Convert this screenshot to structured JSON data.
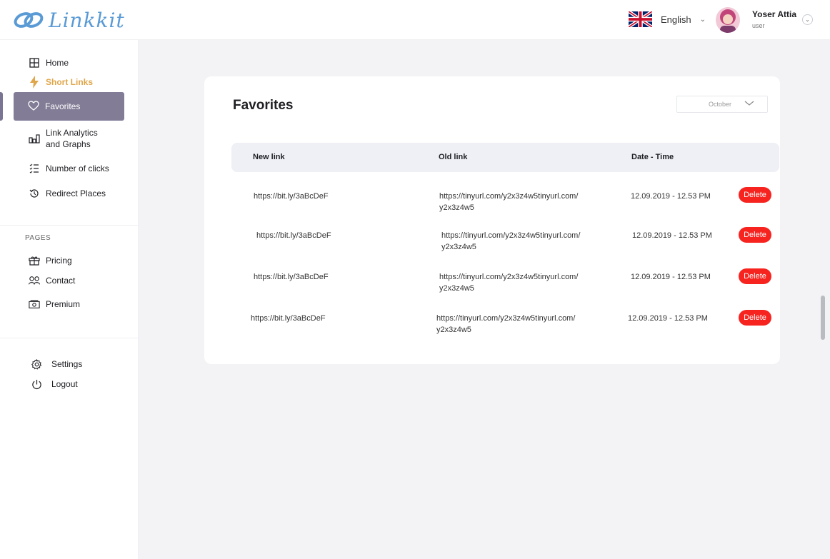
{
  "app": {
    "name": "Linkkit"
  },
  "header": {
    "language": "English",
    "user_name": "Yoser Attia",
    "user_role": "user"
  },
  "sidebar": {
    "items": [
      {
        "label": "Home",
        "icon": "grid-icon"
      },
      {
        "label": "Short Links",
        "icon": "bolt-icon"
      },
      {
        "label": "Favorites",
        "icon": "heart-icon"
      },
      {
        "label": "Link Analytics and Graphs",
        "icon": "bar-chart-icon"
      },
      {
        "label": "Number of clicks",
        "icon": "checklist-icon"
      },
      {
        "label": "Redirect Places",
        "icon": "history-icon"
      }
    ],
    "pages_label": "PAGES",
    "pages": [
      {
        "label": "Pricing",
        "icon": "gift-icon"
      },
      {
        "label": "Contact",
        "icon": "users-icon"
      },
      {
        "label": "Premium",
        "icon": "money-icon"
      }
    ],
    "bottom": [
      {
        "label": "Settings",
        "icon": "gear-icon"
      },
      {
        "label": "Logout",
        "icon": "power-icon"
      }
    ]
  },
  "main": {
    "title": "Favorites",
    "month": "October",
    "columns": [
      "New link",
      "Old link",
      "Date - Time"
    ],
    "rows": [
      {
        "new_link": "https://bit.ly/3aBcDeF",
        "old_link": "https://tinyurl.com/y2x3z4w5tinyurl.com/ y2x3z4w5",
        "datetime": "12.09.2019 - 12.53 PM",
        "action": "Delete"
      },
      {
        "new_link": "https://bit.ly/3aBcDeF",
        "old_link": "https://tinyurl.com/y2x3z4w5tinyurl.com/ y2x3z4w5",
        "datetime": "12.09.2019 - 12.53 PM",
        "action": "Delete"
      },
      {
        "new_link": "https://bit.ly/3aBcDeF",
        "old_link": "https://tinyurl.com/y2x3z4w5tinyurl.com/ y2x3z4w5",
        "datetime": "12.09.2019 - 12.53 PM",
        "action": "Delete"
      },
      {
        "new_link": "https://bit.ly/3aBcDeF",
        "old_link": "https://tinyurl.com/y2x3z4w5tinyurl.com/ y2x3z4w5",
        "datetime": "12.09.2019 - 12.53 PM",
        "action": "Delete"
      }
    ]
  },
  "colors": {
    "accent_active": "#827c96",
    "short_links": "#e0a64a",
    "delete": "#f6231f",
    "logo": "#5a9bd6"
  }
}
